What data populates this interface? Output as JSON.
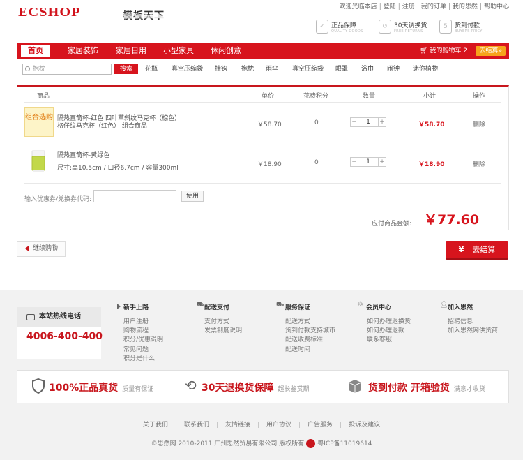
{
  "header": {
    "logo": "ECSHOP",
    "logo_sub": "模板天下",
    "top_links": [
      "欢迎光临本店",
      "登陆",
      "注册",
      "我的订单",
      "我的思然",
      "帮助中心"
    ],
    "promises": [
      {
        "title": "正品保障",
        "sub": "QUALITY GOODS"
      },
      {
        "title": "30天调换货",
        "sub": "FREE RETURNS"
      },
      {
        "title": "货到付款",
        "sub": "BUYERS PRICY"
      }
    ]
  },
  "nav": {
    "items": [
      "首页",
      "家居装饰",
      "家居日用",
      "小型家具",
      "休闲创意"
    ],
    "cart_label": "我的购物车 2",
    "checkout_label": "去结算»"
  },
  "search": {
    "placeholder": "抱枕",
    "button": "搜索",
    "keywords": [
      "花瓶",
      "真空压缩袋",
      "挂钩",
      "抱枕",
      "雨伞",
      "真空压缩袋",
      "眼罩",
      "浴巾",
      "闹钟",
      "迷你植物"
    ]
  },
  "cart": {
    "headers": [
      "商品",
      "单价",
      "花费积分",
      "数量",
      "小计",
      "操作"
    ],
    "rows": [
      {
        "badge": "组合选购",
        "name": "隔热直筒杯-红色  四叶草斜纹马克杯（棕色）",
        "name2": "格仔纹马克杯（红色）  组合商品",
        "price": "￥58.70",
        "points": "0",
        "qty": "1",
        "subtotal": "￥58.70",
        "action": "删除"
      },
      {
        "name": "隔热直筒杯-黄绿色",
        "name2": "尺寸:高10.5cm / 口径6.7cm / 容量300ml",
        "price": "￥18.90",
        "points": "0",
        "qty": "1",
        "subtotal": "￥18.90",
        "action": "删除"
      }
    ],
    "coupon_label": "输入优惠券/兑换券代码:",
    "coupon_value": "",
    "coupon_button": "使用",
    "total_label": "应付商品金额:",
    "total_value": "￥77.60",
    "continue_label": "继续购物",
    "checkout_label": "去结算",
    "checkout_icon": "¥"
  },
  "footer": {
    "hotline_title": "本站热线电话",
    "hotline_number": "4006-400-400",
    "columns": [
      {
        "title": "新手上路",
        "items": [
          "用户注册",
          "购物流程",
          "积分/优惠说明",
          "常见问题",
          "积分是什么"
        ]
      },
      {
        "title": "配送支付",
        "items": [
          "支付方式",
          "发票制度说明"
        ]
      },
      {
        "title": "服务保证",
        "items": [
          "配送方式",
          "货到付款支持城市",
          "配送收费标准",
          "配送时间"
        ]
      },
      {
        "title": "会员中心",
        "items": [
          "如何办理退换货",
          "如何办理退款",
          "联系客服"
        ]
      },
      {
        "title": "加入思然",
        "items": [
          "招聘信息",
          "加入思然网供货商"
        ]
      }
    ],
    "guarantees": [
      {
        "big": "100%正品真货",
        "small": "质量有保证"
      },
      {
        "big": "30天退换货保障",
        "small": "超长鉴赏期"
      },
      {
        "big": "货到付款  开箱验货",
        "small": "满意才收货"
      }
    ],
    "bottom_links": [
      "关于我们",
      "联系我们",
      "友情链接",
      "用户协议",
      "广告服务",
      "投诉及建议"
    ],
    "copyright": "©思然网  2010-2011  广州思然贸易有限公司  版权所有",
    "icp": "粤ICP备11019614"
  },
  "colors": {
    "brand_red": "#d7141d",
    "checkout_orange": "#f7a31b",
    "hotline_red": "#c8161d"
  }
}
